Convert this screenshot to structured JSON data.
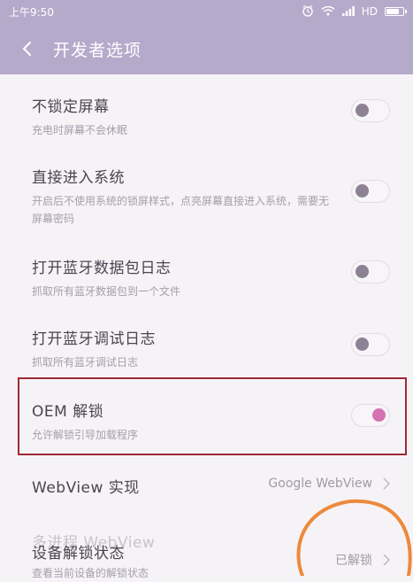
{
  "status_bar": {
    "time": "上午9:50",
    "network_label": "HD",
    "icons": [
      "alarm-icon",
      "wifi-icon",
      "signal-icon",
      "battery-icon"
    ]
  },
  "header": {
    "title": "开发者选项",
    "back_icon": "chevron-left-icon"
  },
  "settings": [
    {
      "title": "不锁定屏幕",
      "subtitle": "充电时屏幕不会休眠",
      "toggle_on": false
    },
    {
      "title": "直接进入系统",
      "subtitle": "开启后不使用系统的锁屏样式，点亮屏幕直接进入系统，需要无屏幕密码",
      "toggle_on": false
    },
    {
      "title": "打开蓝牙数据包日志",
      "subtitle": "抓取所有蓝牙数据包到一个文件",
      "toggle_on": false
    },
    {
      "title": "打开蓝牙调试日志",
      "subtitle": "抓取所有蓝牙调试日志",
      "toggle_on": false
    },
    {
      "title": "OEM 解锁",
      "subtitle": "允许解锁引导加载程序",
      "toggle_on": true
    }
  ],
  "webview": {
    "title": "WebView 实现",
    "value": "Google WebView"
  },
  "multiprocess": {
    "title": "多进程 WebView"
  },
  "device_unlock": {
    "title": "设备解锁状态",
    "subtitle": "查看当前设备的解锁状态",
    "value": "已解锁"
  },
  "colors": {
    "accent": "#b6aacb",
    "toggle_on": "#d572b2",
    "highlight_border": "#9e2a35",
    "annotation": "#ec8a3c"
  }
}
